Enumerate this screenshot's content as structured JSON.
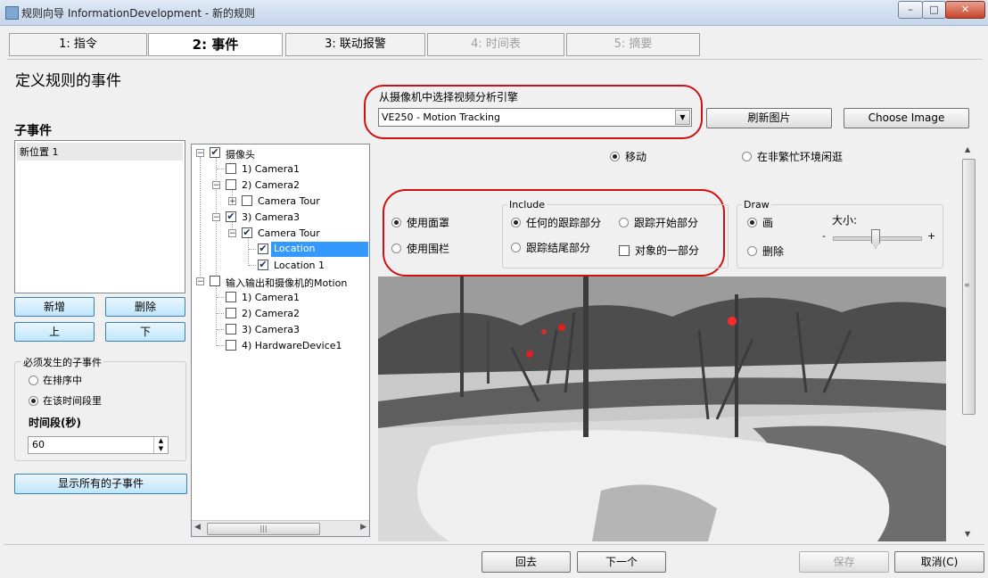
{
  "window": {
    "title": "规则向导 InformationDevelopment - 新的规则",
    "controls": [
      "minimize-icon",
      "maximize-icon",
      "close-icon"
    ]
  },
  "tabs": [
    {
      "label": "1: 指令"
    },
    {
      "label": "2: 事件"
    },
    {
      "label": "3: 联动报警"
    },
    {
      "label": "4: 时间表"
    },
    {
      "label": "5: 摘要"
    }
  ],
  "page_title": "定义规则的事件",
  "sub_events": {
    "heading": "子事件",
    "items": [
      "新位置 1"
    ],
    "buttons": {
      "add": "新增",
      "delete": "删除",
      "up": "上",
      "down": "下"
    },
    "required_group": {
      "label": "必须发生的子事件",
      "opt_sequence": "在排序中",
      "opt_timespan": "在该时间段里",
      "selected": "在该时间段里"
    },
    "timespan_label": "时间段(秒)",
    "timespan_value": "60",
    "show_all": "显示所有的子事件"
  },
  "tree": {
    "cameras_root": "摄像头",
    "camera1": "1) Camera1",
    "camera2": "2) Camera2",
    "camera2_tour": "Camera Tour",
    "camera3": "3) Camera3",
    "camera3_tour": "Camera Tour",
    "location": "Location",
    "location1": "Location 1",
    "io_root": "输入输出和摄像机的Motion",
    "io_cam1": "1) Camera1",
    "io_cam2": "2) Camera2",
    "io_cam3": "3) Camera3",
    "io_hw": "4) HardwareDevice1"
  },
  "engine": {
    "label": "从摄像机中选择视频分析引擎",
    "selected": "VE250 - Motion Tracking",
    "refresh_button": "刷新图片",
    "choose_button": "Choose Image"
  },
  "mode": {
    "move": "移动",
    "idle": "在非繁忙环境闲逛",
    "selected": "移动"
  },
  "mask": {
    "use_mask": "使用面罩",
    "use_fence": "使用围栏",
    "selected": "使用面罩"
  },
  "include": {
    "label": "Include",
    "any_part": "任何的跟踪部分",
    "start_part": "跟踪开始部分",
    "end_part": "跟踪结尾部分",
    "object_part": "对象的一部分",
    "selected": "任何的跟踪部分",
    "object_part_checked": false
  },
  "draw": {
    "label": "Draw",
    "paint": "画",
    "erase": "删除",
    "size_label": "大小:",
    "minus": "-",
    "plus": "+",
    "selected": "画"
  },
  "footer": {
    "back": "回去",
    "next": "下一个",
    "save": "保存",
    "cancel": "取消(C)"
  },
  "colors": {
    "highlight": "#3399ff",
    "annotation": "#d01010"
  }
}
